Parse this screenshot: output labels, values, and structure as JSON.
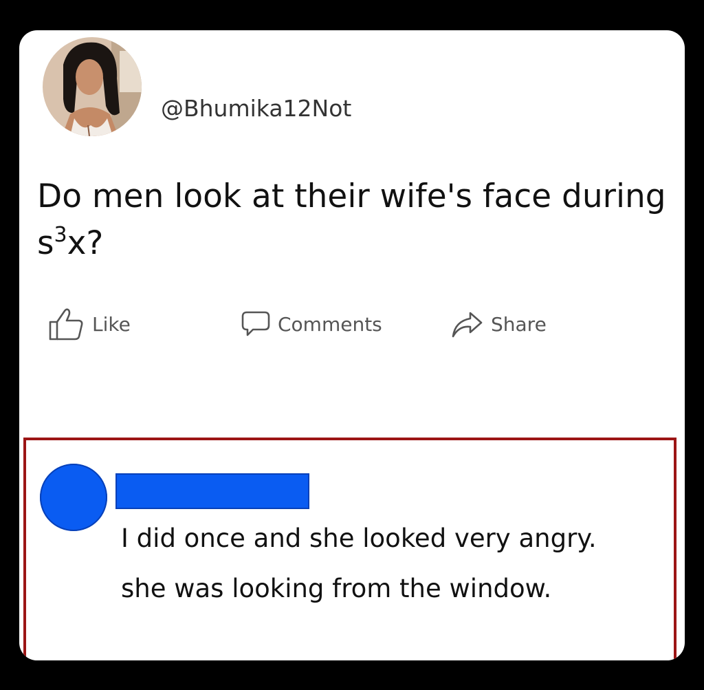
{
  "post": {
    "username": "@Bhumika12Not",
    "text_main": "Do men look at their wife's face during s",
    "text_sup": "3",
    "text_end": "x?"
  },
  "actions": {
    "like_label": "Like",
    "comments_label": "Comments",
    "share_label": "Share",
    "like_icon": "thumbs-up-icon",
    "comments_icon": "speech-bubble-icon",
    "share_icon": "share-arrow-icon"
  },
  "comment": {
    "line1": "I did once and she looked very angry.",
    "line2": "she was looking from the window."
  },
  "colors": {
    "background": "#000000",
    "card": "#ffffff",
    "comment_border": "#9c1515",
    "redaction_blue": "#0a5cf2",
    "action_text": "#555555"
  }
}
